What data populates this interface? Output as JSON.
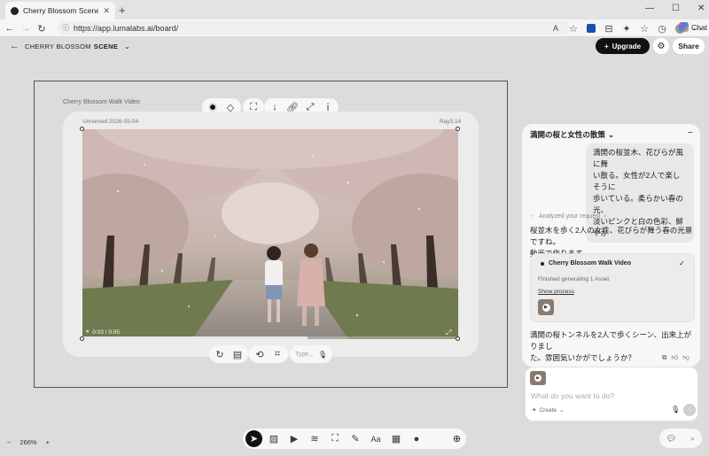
{
  "browser": {
    "tab_title": "Cherry Blossom Scene | Luma",
    "url": "https://app.lumalabs.ai/board/",
    "chat_label": "Chat",
    "translate_label": "A"
  },
  "header": {
    "board_title_prefix": "CHERRY BLOSSOM",
    "board_title_strong": "SCENE",
    "upgrade_label": "Upgrade",
    "share_label": "Share"
  },
  "canvas": {
    "group_title": "Cherry Blossom Walk Video",
    "card_name": "Unnamed 2026-05-04",
    "card_model": "Ray3.14",
    "player_time": "0:03 / 0:05",
    "progress_fraction": 0.6,
    "prompt_placeholder": "Type..."
  },
  "chat": {
    "title": "満開の桜と女性の散策",
    "user_message_lines": [
      "満開の桜並木、花びらが風に舞",
      "い散る。女性が2人で楽しそうに",
      "歩いている。柔らかい春の光、",
      "淡いピンクと白の色彩、鮮やか"
    ],
    "analyzed_label": "Analyzed your request",
    "reply1_lines": [
      "桜並木を歩く2人の女性、花びらが舞う春の光景ですね。",
      "動画で作ります。"
    ],
    "task_title": "Cherry Blossom Walk Video",
    "task_status": "Finished generating 1 Asset",
    "show_process": "Show process",
    "reply2_lines": [
      "満開の桜トンネルを2人で歩くシーン、出来上がりまし",
      "た。雰囲気いかがでしょうか？"
    ],
    "input_placeholder": "What do you want to do?",
    "create_label": "Create"
  },
  "zoom": {
    "minus": "−",
    "level": "266%",
    "plus": "+"
  },
  "toolbar": {
    "text_tool_label": "Aa"
  },
  "colors": {
    "accent_dark": "#111111",
    "page_bg": "#dcdcdc",
    "panel_bg": "#f7f7f7"
  },
  "icons": [
    "back-arrow-icon",
    "forward-arrow-icon",
    "reload-icon",
    "star-icon",
    "settings-gear-icon",
    "pointer-icon",
    "image-icon",
    "video-icon",
    "audio-icon",
    "frame-icon",
    "draw-icon",
    "board-icon",
    "record-icon",
    "add-icon",
    "chat-bubble-icon",
    "search-icon",
    "mic-icon",
    "send-icon",
    "play-icon",
    "expand-icon"
  ]
}
